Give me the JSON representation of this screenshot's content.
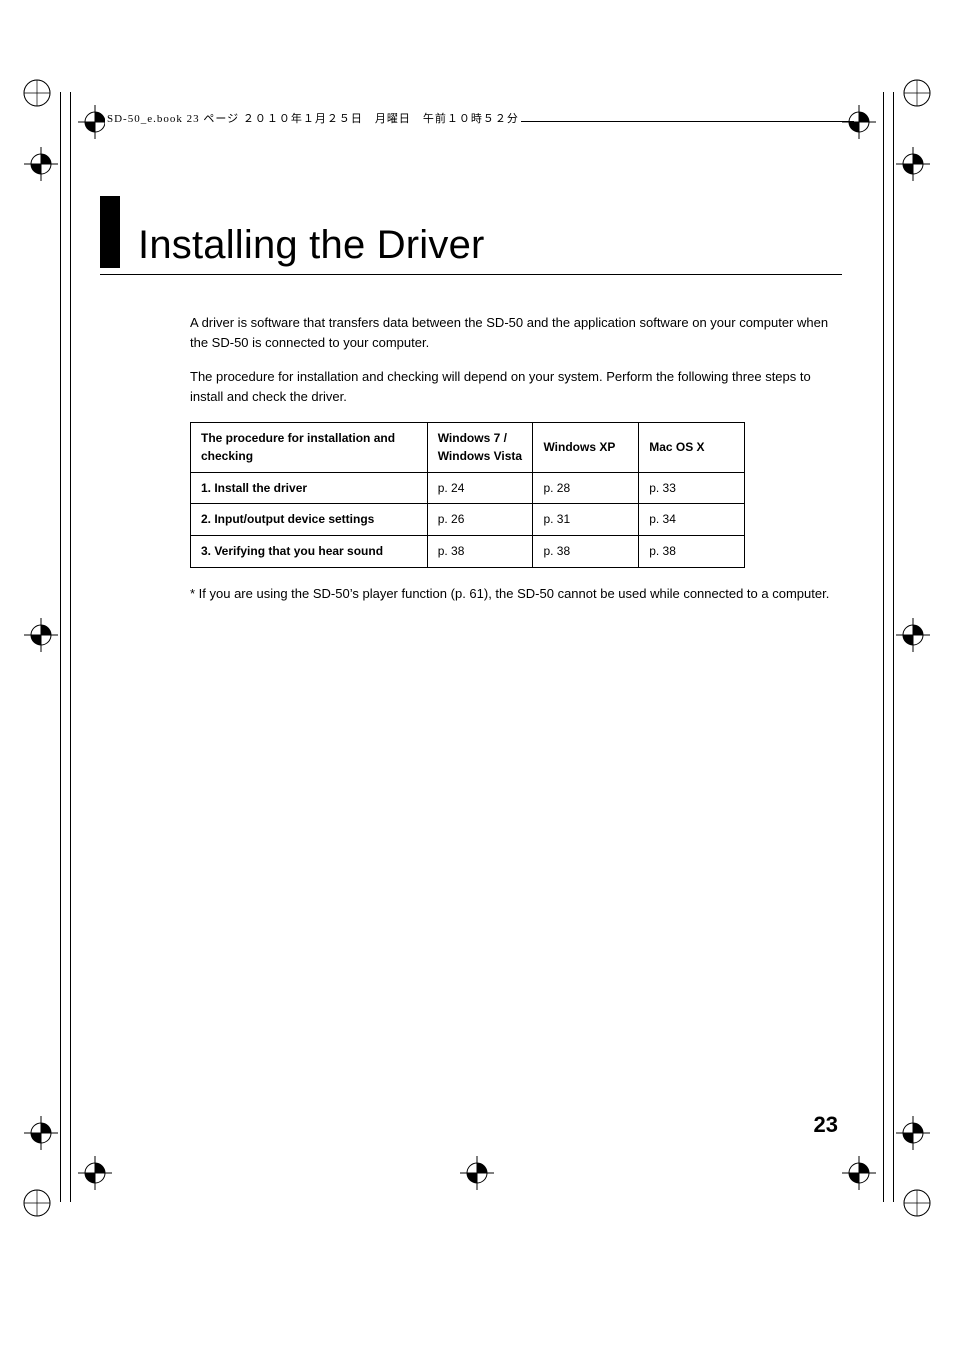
{
  "header_caption": "SD-50_e.book  23 ページ  ２０１０年１月２５日　月曜日　午前１０時５２分",
  "title": "Installing the Driver",
  "paragraphs": {
    "p1": "A driver is software that transfers data between the SD-50 and the application software on your computer when the SD-50 is connected to your computer.",
    "p2": "The procedure for installation and checking will depend on your system. Perform the following three steps to install and check the driver."
  },
  "table": {
    "headers": {
      "c0": "The procedure for installation and checking",
      "c1_a": "Windows 7 /",
      "c1_b": "Windows Vista",
      "c2": "Windows XP",
      "c3": "Mac OS X"
    },
    "rows": [
      {
        "label": "1. Install the driver",
        "win7": "p. 24",
        "xp": "p. 28",
        "mac": "p. 33"
      },
      {
        "label": "2. Input/output device settings",
        "win7": "p. 26",
        "xp": "p. 31",
        "mac": "p. 34"
      },
      {
        "label": "3. Verifying that you hear sound",
        "win7": "p. 38",
        "xp": "p. 38",
        "mac": "p. 38"
      }
    ]
  },
  "footnote": "*  If you are using the SD-50’s player function (p. 61), the SD-50 cannot be used while connected to a computer.",
  "page_number": "23"
}
